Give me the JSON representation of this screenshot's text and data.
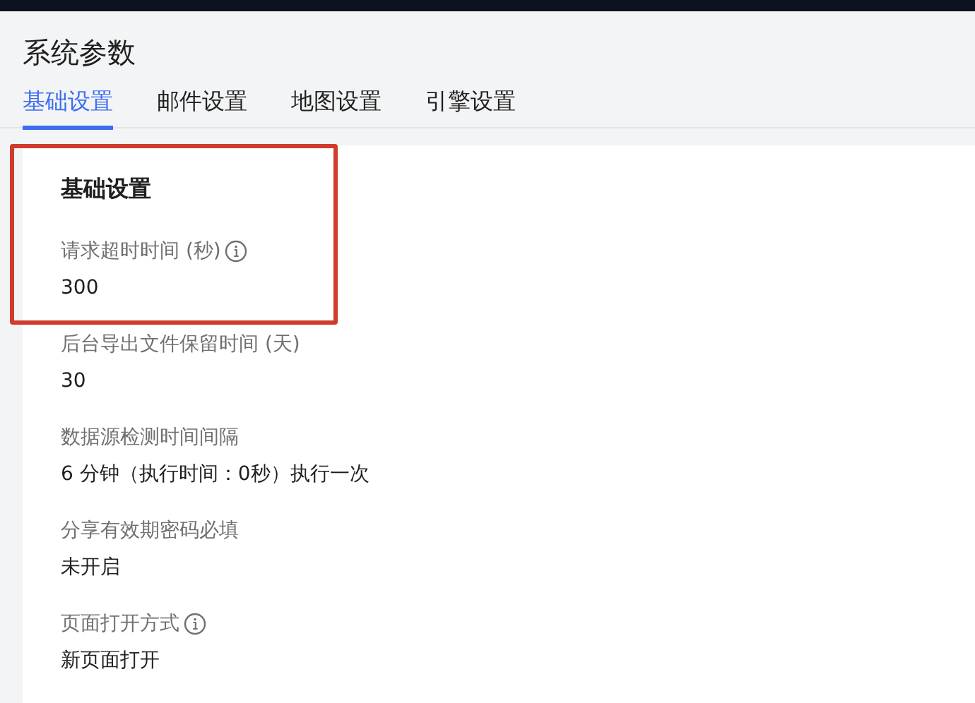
{
  "page": {
    "title": "系统参数"
  },
  "tabs": [
    {
      "label": "基础设置",
      "selected": true
    },
    {
      "label": "邮件设置",
      "selected": false
    },
    {
      "label": "地图设置",
      "selected": false
    },
    {
      "label": "引擎设置",
      "selected": false
    }
  ],
  "section": {
    "title": "基础设置",
    "highlighted": true
  },
  "settings": [
    {
      "label": "请求超时时间 (秒)",
      "info": true,
      "value": "300"
    },
    {
      "label": "后台导出文件保留时间 (天)",
      "info": false,
      "value": "30"
    },
    {
      "label": "数据源检测时间间隔",
      "info": false,
      "value": "6 分钟（执行时间：0秒）执行一次"
    },
    {
      "label": "分享有效期密码必填",
      "info": false,
      "value": "未开启"
    },
    {
      "label": "页面打开方式",
      "info": true,
      "value": "新页面打开"
    }
  ]
}
